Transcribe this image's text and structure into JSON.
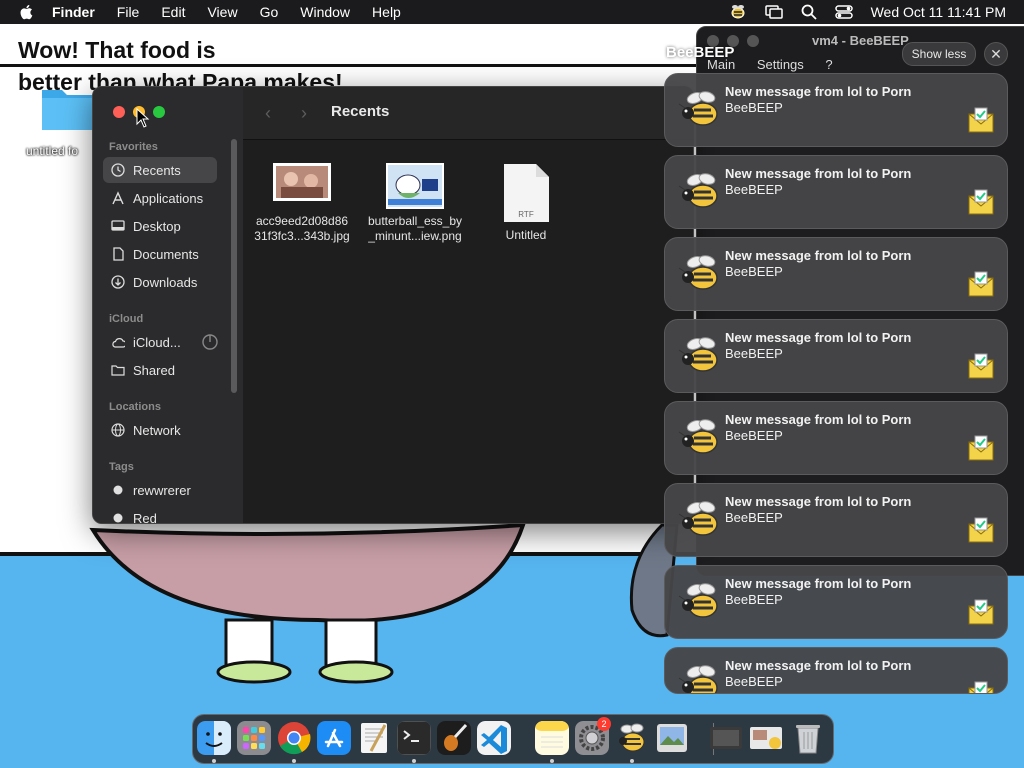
{
  "wallpaper": {
    "title_line1": "Wow! That food is",
    "title_line2": "better than what Papa makes!"
  },
  "desktop": {
    "folder_label": "untitled fo"
  },
  "menubar": {
    "app": "Finder",
    "items": [
      "File",
      "Edit",
      "View",
      "Go",
      "Window",
      "Help"
    ],
    "datetime": "Wed Oct 11  11:41 PM"
  },
  "finder": {
    "title": "Recents",
    "sidebar": {
      "favorites_header": "Favorites",
      "favorites": [
        "Recents",
        "Applications",
        "Desktop",
        "Documents",
        "Downloads"
      ],
      "icloud_header": "iCloud",
      "icloud": [
        "iCloud...",
        "Shared"
      ],
      "locations_header": "Locations",
      "locations": [
        "Network"
      ],
      "tags_header": "Tags",
      "tags": [
        "rewwrerer",
        "Red"
      ]
    },
    "files": [
      {
        "line1": "acc9eed2d08d86",
        "line2": "31f3fc3...343b.jpg"
      },
      {
        "line1": "butterball_ess_by",
        "line2": "_minunt...iew.png"
      },
      {
        "line1": "Untitled",
        "line2": "",
        "badge": "RTF"
      }
    ]
  },
  "beebeep_window": {
    "title": "vm4 - BeeBEEP",
    "menu": [
      "Main",
      "Settings",
      "?"
    ]
  },
  "notifications": {
    "app_name": "BeeBEEP",
    "show_less": "Show less",
    "items": [
      {
        "title": "New message from lol to Porn",
        "body": "BeeBEEP"
      },
      {
        "title": "New message from lol to Porn",
        "body": "BeeBEEP"
      },
      {
        "title": "New message from lol to Porn",
        "body": "BeeBEEP"
      },
      {
        "title": "New message from lol to Porn",
        "body": "BeeBEEP"
      },
      {
        "title": "New message from lol to Porn",
        "body": "BeeBEEP"
      },
      {
        "title": "New message from lol to Porn",
        "body": "BeeBEEP"
      },
      {
        "title": "New message from lol to Porn",
        "body": "BeeBEEP"
      },
      {
        "title": "New message from lol to Porn",
        "body": "BeeBEEP"
      }
    ]
  },
  "dock": {
    "settings_badge": "2"
  },
  "colors": {
    "ground": "#56b4ee",
    "notification_bg": "#464648",
    "selected_sidebar": "#464649"
  }
}
